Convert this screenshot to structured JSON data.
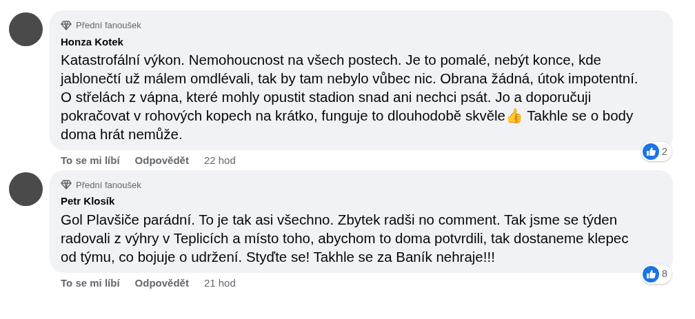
{
  "comments": [
    {
      "badge": "Přední fanoušek",
      "author": "Honza Kotek",
      "text": "Katastrofální výkon. Nemohoucnost na všech postech. Je to pomalé, nebýt konce, kde jablonečtí už málem omdlévali, tak by tam nebylo vůbec nic. Obrana žádná, útok impotentní. O střelách z vápna, které mohly opustit stadion snad ani nechci psát. Jo a doporučuji pokračovat v rohových kopech na krátko, funguje to dlouhodobě skvěle👍 Takhle se o body doma hrát nemůže.",
      "like": "To se mi líbí",
      "reply": "Odpovědět",
      "time": "22 hod",
      "reactions": "2"
    },
    {
      "badge": "Přední fanoušek",
      "author": "Petr Klosík",
      "text": "Gol Plavšiče parádní. To je tak asi všechno. Zbytek radši no comment. Tak jsme se týden radovali z výhry v Teplicích a místo toho, abychom to doma potvrdili, tak dostaneme klepec od týmu, co bojuje o udržení. Styďte se! Takhle se za Baník nehraje!!!",
      "like": "To se mi líbí",
      "reply": "Odpovědět",
      "time": "21 hod",
      "reactions": "8"
    }
  ]
}
